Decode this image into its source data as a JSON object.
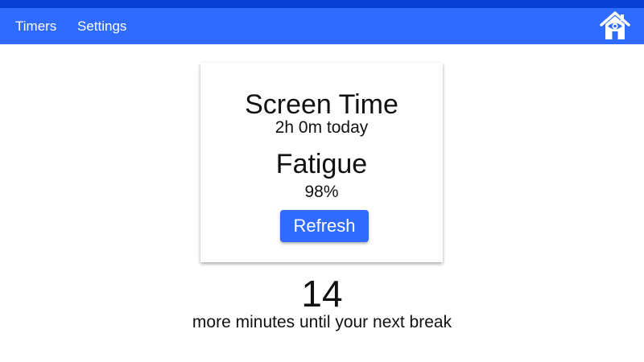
{
  "nav": {
    "items": [
      {
        "label": "Timers"
      },
      {
        "label": "Settings"
      }
    ],
    "home_icon": "house-with-eye-icon",
    "background_color": "#2f6bff",
    "top_strip_color": "#0a3fd6"
  },
  "card": {
    "screen_time_title": "Screen Time",
    "screen_time_value": "2h 0m today",
    "fatigue_title": "Fatigue",
    "fatigue_value": "98%",
    "refresh_label": "Refresh"
  },
  "countdown": {
    "minutes": "14",
    "caption": "more minutes until your next break"
  }
}
